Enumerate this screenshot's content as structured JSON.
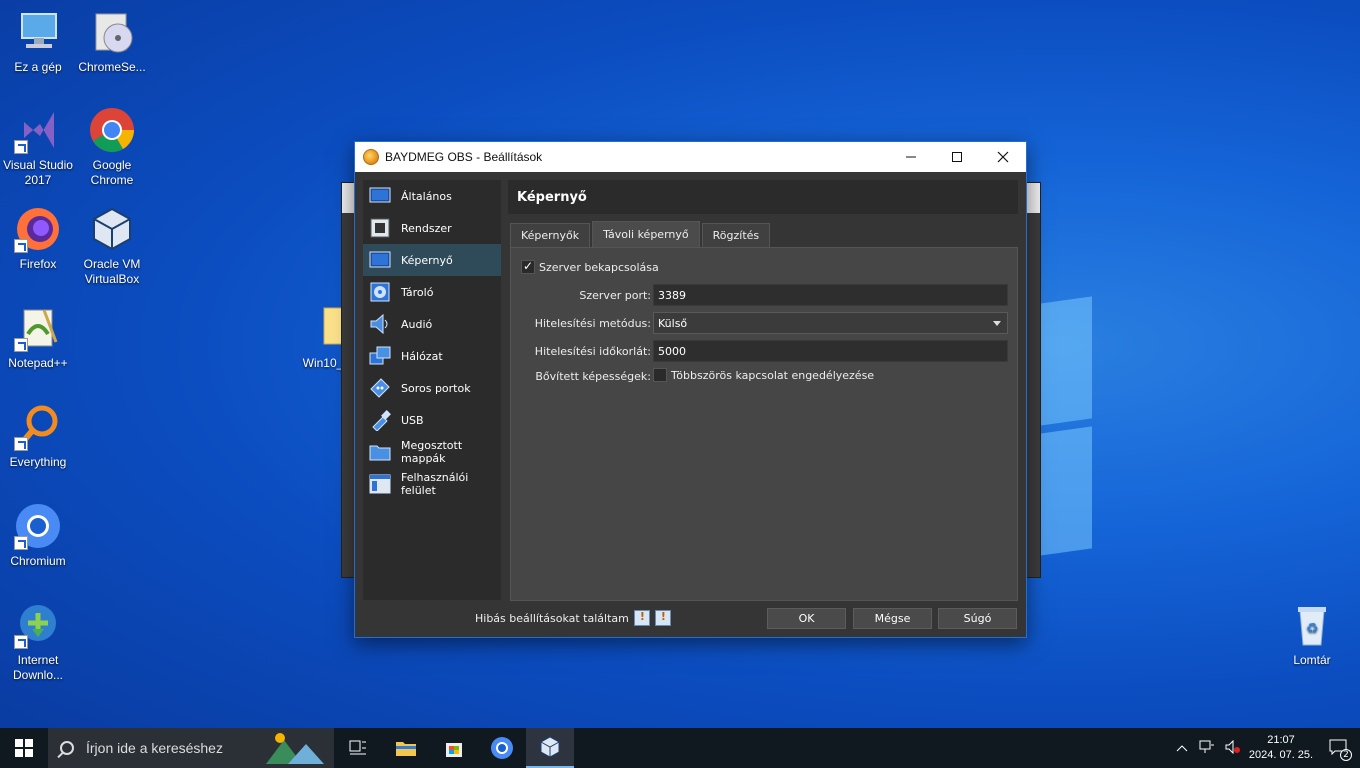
{
  "desktop": {
    "icons": [
      {
        "label": "Ez a gép",
        "icon": "computer-icon"
      },
      {
        "label": "ChromeSe...",
        "icon": "disc-installer-icon"
      },
      {
        "label": "Visual Studio 2017",
        "icon": "visual-studio-icon"
      },
      {
        "label": "Google Chrome",
        "icon": "chrome-icon"
      },
      {
        "label": "Firefox",
        "icon": "firefox-icon"
      },
      {
        "label": "Oracle VM VirtualBox",
        "icon": "virtualbox-icon"
      },
      {
        "label": "Notepad++",
        "icon": "notepadpp-icon"
      },
      {
        "label": "Win10_...",
        "icon": "folder-file-icon"
      },
      {
        "label": "Everything",
        "icon": "everything-search-icon"
      },
      {
        "label": "Chromium",
        "icon": "chromium-icon"
      },
      {
        "label": "Internet Downlo...",
        "icon": "idm-icon"
      },
      {
        "label": "Lomtár",
        "icon": "recycle-bin-icon"
      }
    ]
  },
  "dialog": {
    "title": "BAYDMEG OBS - Beállítások",
    "sidebar": [
      {
        "label": "Általános",
        "icon": "general-icon",
        "active": false
      },
      {
        "label": "Rendszer",
        "icon": "system-chip-icon",
        "active": false
      },
      {
        "label": "Képernyő",
        "icon": "monitor-icon",
        "active": true
      },
      {
        "label": "Tároló",
        "icon": "storage-disk-icon",
        "active": false
      },
      {
        "label": "Audió",
        "icon": "speaker-icon",
        "active": false
      },
      {
        "label": "Hálózat",
        "icon": "network-icon",
        "active": false
      },
      {
        "label": "Soros portok",
        "icon": "serial-port-icon",
        "active": false
      },
      {
        "label": "USB",
        "icon": "usb-icon",
        "active": false
      },
      {
        "label": "Megosztott mappák",
        "icon": "shared-folder-icon",
        "active": false
      },
      {
        "label": "Felhasználói felület",
        "icon": "user-interface-icon",
        "active": false
      }
    ],
    "section_title": "Képernyő",
    "tabs": [
      "Képernyők",
      "Távoli képernyő",
      "Rögzítés"
    ],
    "active_tab": 1,
    "enable_server": {
      "label": "Szerver bekapcsolása",
      "checked": true
    },
    "server_port": {
      "label": "Szerver port:",
      "value": "3389"
    },
    "auth_method": {
      "label": "Hitelesítési metódus:",
      "value": "Külső"
    },
    "auth_timeout": {
      "label": "Hitelesítési időkorlát:",
      "value": "5000"
    },
    "extended": {
      "label": "Bővített képességek:",
      "option": "Többszörös kapcsolat engedélyezése",
      "checked": false
    },
    "status_message": "Hibás beállításokat találtam",
    "buttons": {
      "ok": "OK",
      "cancel": "Mégse",
      "help": "Súgó"
    }
  },
  "taskbar": {
    "search_placeholder": "Írjon ide a kereséshez",
    "time": "21:07",
    "date": "2024. 07. 25.",
    "notification_count": "2"
  }
}
